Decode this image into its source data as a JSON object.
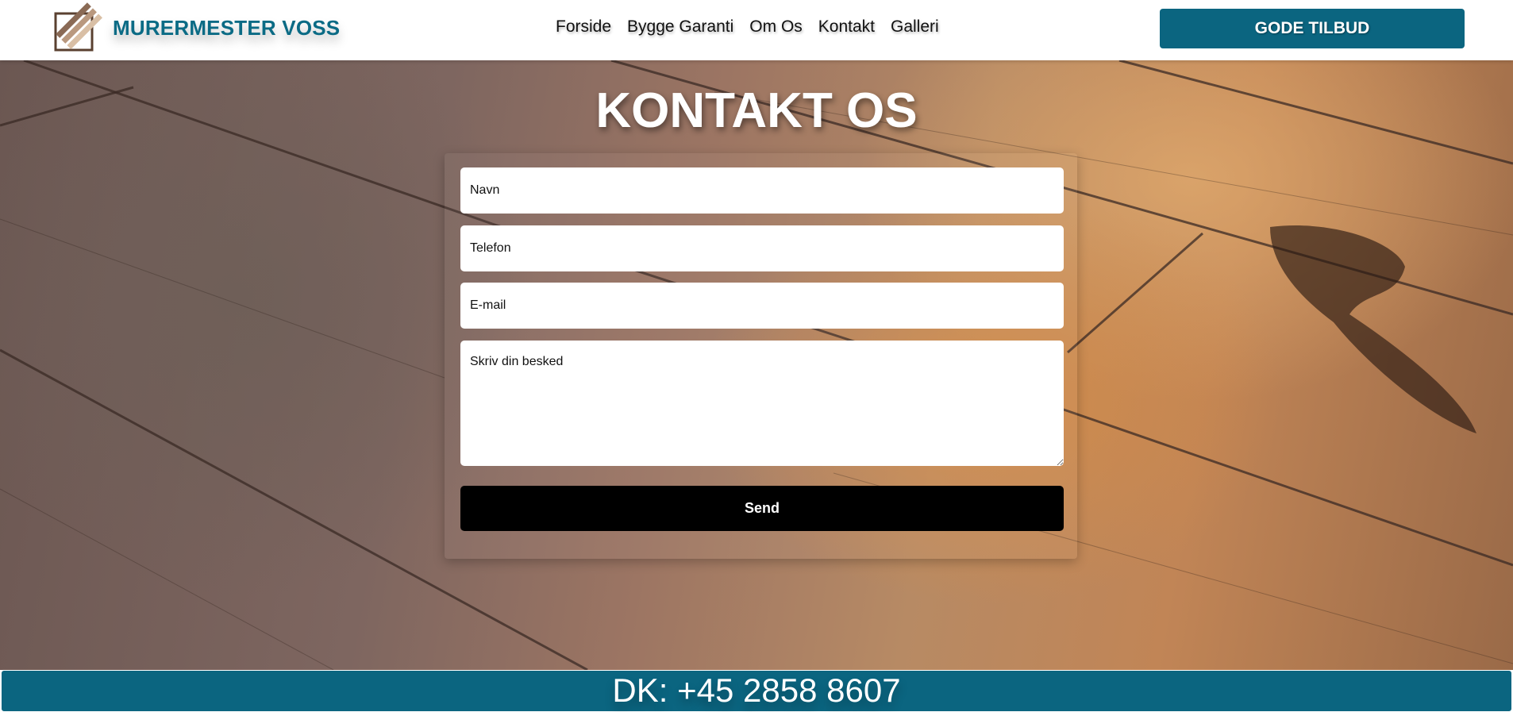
{
  "header": {
    "brand": "MURERMESTER VOSS",
    "nav": [
      {
        "label": "Forside"
      },
      {
        "label": "Bygge Garanti"
      },
      {
        "label": "Om Os"
      },
      {
        "label": "Kontakt"
      },
      {
        "label": "Galleri"
      }
    ],
    "cta_label": "GODE TILBUD"
  },
  "main": {
    "title": "KONTAKT OS",
    "form": {
      "name_placeholder": "Navn",
      "phone_placeholder": "Telefon",
      "email_placeholder": "E-mail",
      "message_placeholder": "Skriv din besked",
      "send_label": "Send"
    }
  },
  "footer": {
    "phone": "DK: +45 2858 8607"
  },
  "colors": {
    "brand_teal": "#0b6580",
    "send_button": "#000000"
  },
  "icons": [
    "brick-logo-icon"
  ]
}
